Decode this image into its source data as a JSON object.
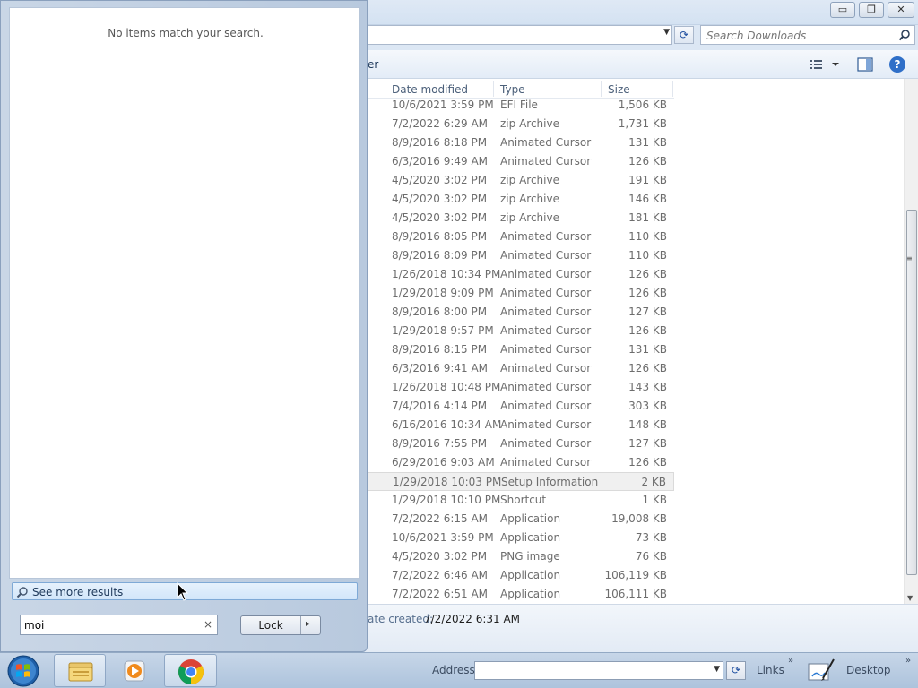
{
  "explorer": {
    "caption_buttons": {
      "minimize": "▭",
      "restore": "❐",
      "close": "✕"
    },
    "search": {
      "placeholder": "Search Downloads"
    },
    "toolbar_partial": "er",
    "help_label": "?",
    "columns": {
      "date": "Date modified",
      "type": "Type",
      "size": "Size"
    },
    "files": [
      {
        "date": "10/6/2021 3:59 PM",
        "type": "EFI File",
        "size": "1,506 KB"
      },
      {
        "date": "7/2/2022 6:29 AM",
        "type": "zip Archive",
        "size": "1,731 KB"
      },
      {
        "date": "8/9/2016 8:18 PM",
        "type": "Animated Cursor",
        "size": "131 KB"
      },
      {
        "date": "6/3/2016 9:49 AM",
        "type": "Animated Cursor",
        "size": "126 KB"
      },
      {
        "date": "4/5/2020 3:02 PM",
        "type": "zip Archive",
        "size": "191 KB"
      },
      {
        "date": "4/5/2020 3:02 PM",
        "type": "zip Archive",
        "size": "146 KB"
      },
      {
        "date": "4/5/2020 3:02 PM",
        "type": "zip Archive",
        "size": "181 KB"
      },
      {
        "date": "8/9/2016 8:05 PM",
        "type": "Animated Cursor",
        "size": "110 KB"
      },
      {
        "date": "8/9/2016 8:09 PM",
        "type": "Animated Cursor",
        "size": "110 KB"
      },
      {
        "date": "1/26/2018 10:34 PM",
        "type": "Animated Cursor",
        "size": "126 KB"
      },
      {
        "date": "1/29/2018 9:09 PM",
        "type": "Animated Cursor",
        "size": "126 KB"
      },
      {
        "date": "8/9/2016 8:00 PM",
        "type": "Animated Cursor",
        "size": "127 KB"
      },
      {
        "date": "1/29/2018 9:57 PM",
        "type": "Animated Cursor",
        "size": "126 KB"
      },
      {
        "date": "8/9/2016 8:15 PM",
        "type": "Animated Cursor",
        "size": "131 KB"
      },
      {
        "date": "6/3/2016 9:41 AM",
        "type": "Animated Cursor",
        "size": "126 KB"
      },
      {
        "date": "1/26/2018 10:48 PM",
        "type": "Animated Cursor",
        "size": "143 KB"
      },
      {
        "date": "7/4/2016 4:14 PM",
        "type": "Animated Cursor",
        "size": "303 KB"
      },
      {
        "date": "6/16/2016 10:34 AM",
        "type": "Animated Cursor",
        "size": "148 KB"
      },
      {
        "date": "8/9/2016 7:55 PM",
        "type": "Animated Cursor",
        "size": "127 KB"
      },
      {
        "date": "6/29/2016 9:03 AM",
        "type": "Animated Cursor",
        "size": "126 KB"
      },
      {
        "date": "1/29/2018 10:03 PM",
        "type": "Setup Information",
        "size": "2 KB",
        "selected": true
      },
      {
        "date": "1/29/2018 10:10 PM",
        "type": "Shortcut",
        "size": "1 KB"
      },
      {
        "date": "7/2/2022 6:15 AM",
        "type": "Application",
        "size": "19,008 KB"
      },
      {
        "date": "10/6/2021 3:59 PM",
        "type": "Application",
        "size": "73 KB"
      },
      {
        "date": "4/5/2020 3:02 PM",
        "type": "PNG image",
        "size": "76 KB"
      },
      {
        "date": "7/2/2022 6:46 AM",
        "type": "Application",
        "size": "106,119 KB"
      },
      {
        "date": "7/2/2022 6:51 AM",
        "type": "Application",
        "size": "106,111 KB"
      }
    ],
    "status": {
      "label": "ate created:",
      "value": "7/2/2022 6:31 AM"
    }
  },
  "start_menu": {
    "no_results_text": "No items match your search.",
    "see_more_label": "See more results",
    "search_value": "moi",
    "clear_symbol": "×",
    "lock_label": "Lock",
    "lock_arrow": "▸"
  },
  "taskbar": {
    "address_label": "Address",
    "address_value": "",
    "links_label": "Links",
    "desktop_label": "Desktop",
    "chevron": "»",
    "apps": [
      "windows-explorer",
      "windows-media-player",
      "google-chrome"
    ]
  },
  "colors": {
    "accent": "#2f6fc8",
    "selected_row": "#f0f0f0",
    "taskbar": "#b9cce2",
    "chrome_red": "#db4437",
    "chrome_yellow": "#f4c20d",
    "chrome_green": "#0f9d58",
    "chrome_blue": "#4285f4"
  }
}
